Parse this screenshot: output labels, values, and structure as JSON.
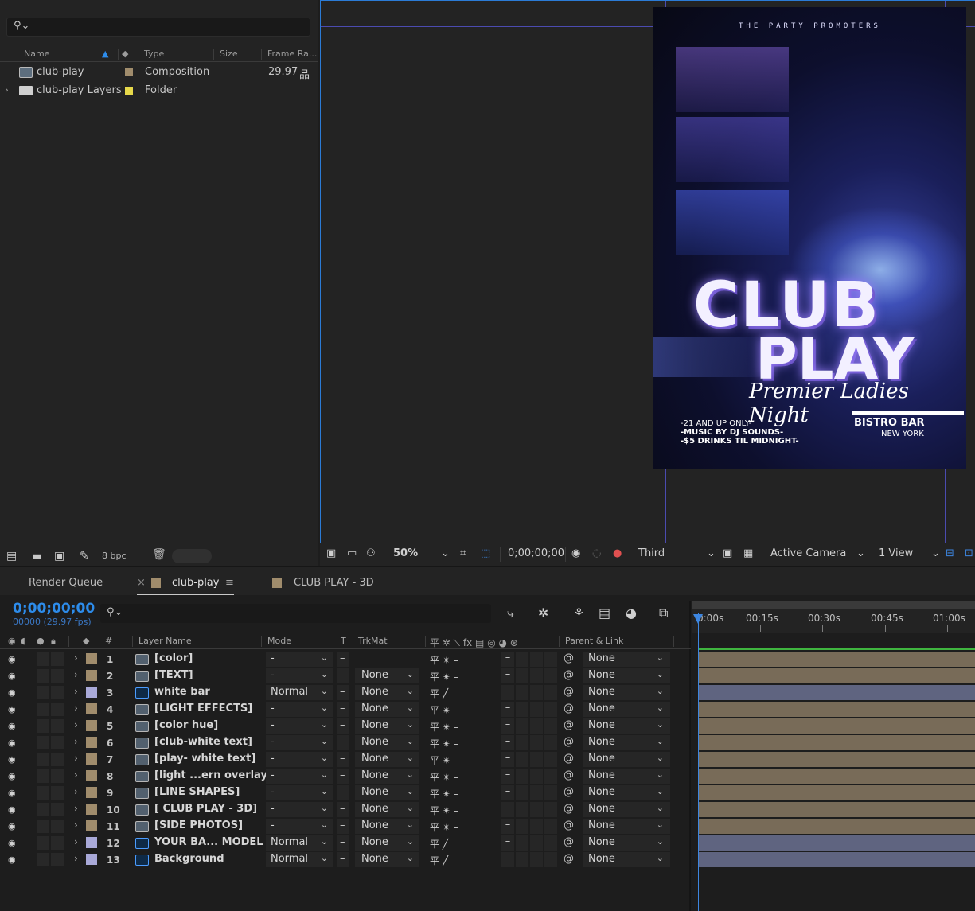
{
  "project": {
    "search_icon": "search-icon",
    "columns": {
      "name": "Name",
      "type": "Type",
      "size": "Size",
      "frame_rate": "Frame Ra..."
    },
    "items": [
      {
        "name": "club-play",
        "type": "Composition",
        "frame_rate": "29.97",
        "color": "#a08c6c"
      },
      {
        "name": "club-play Layers",
        "type": "Folder",
        "frame_rate": "",
        "color": "#e6d84a"
      }
    ],
    "bpc": "8 bpc"
  },
  "poster": {
    "promoters": "THE PARTY PROMOTERS",
    "club": "CLUB",
    "play": "PLAY",
    "premier": "Premier Ladies Night",
    "info": [
      "-21 AND UP ONLY-",
      "-MUSIC BY DJ SOUNDS-",
      "-$5 DRINKS TIL MIDNIGHT-"
    ],
    "bistro": "BISTRO BAR",
    "city": "NEW YORK"
  },
  "viewer_toolbar": {
    "zoom": "50%",
    "timecode": "0;00;00;00",
    "resolution": "Third",
    "camera": "Active Camera",
    "views": "1 View"
  },
  "tabs": {
    "render_queue": "Render Queue",
    "active": "club-play",
    "other": "CLUB PLAY - 3D"
  },
  "timeline": {
    "timecode": "0;00;00;00",
    "frames": "00000 (29.97 fps)",
    "headers": {
      "num": "#",
      "layer_name": "Layer Name",
      "mode": "Mode",
      "t": "T",
      "trkmat": "TrkMat",
      "parent": "Parent & Link"
    },
    "ruler": [
      "0:00s",
      "00:15s",
      "00:30s",
      "00:45s",
      "01:00s"
    ],
    "layers": [
      {
        "num": "1",
        "name": "[color]",
        "kind": "comp",
        "mode": "-",
        "trkmat": "",
        "label": "#a08c6c",
        "sw": "平 ✴ –",
        "parent": "None"
      },
      {
        "num": "2",
        "name": "[TEXT]",
        "kind": "comp",
        "mode": "-",
        "trkmat": "None",
        "label": "#a08c6c",
        "sw": "平 ✴ –",
        "parent": "None"
      },
      {
        "num": "3",
        "name": "white bar",
        "kind": "ps",
        "mode": "Normal",
        "trkmat": "None",
        "label": "#a9a9d8",
        "sw": "平   ╱",
        "parent": "None"
      },
      {
        "num": "4",
        "name": "[LIGHT EFFECTS]",
        "kind": "comp",
        "mode": "-",
        "trkmat": "None",
        "label": "#a08c6c",
        "sw": "平 ✴ –",
        "parent": "None"
      },
      {
        "num": "5",
        "name": "[color hue]",
        "kind": "comp",
        "mode": "-",
        "trkmat": "None",
        "label": "#a08c6c",
        "sw": "平 ✴ –",
        "parent": "None"
      },
      {
        "num": "6",
        "name": "[club-white text]",
        "kind": "comp",
        "mode": "-",
        "trkmat": "None",
        "label": "#a08c6c",
        "sw": "平 ✴ –",
        "parent": "None"
      },
      {
        "num": "7",
        "name": "[play- white text]",
        "kind": "comp",
        "mode": "-",
        "trkmat": "None",
        "label": "#a08c6c",
        "sw": "平 ✴ –",
        "parent": "None"
      },
      {
        "num": "8",
        "name": "[light ...ern overlay]",
        "kind": "comp",
        "mode": "-",
        "trkmat": "None",
        "label": "#a08c6c",
        "sw": "平 ✴ –",
        "parent": "None"
      },
      {
        "num": "9",
        "name": "[LINE SHAPES]",
        "kind": "comp",
        "mode": "-",
        "trkmat": "None",
        "label": "#a08c6c",
        "sw": "平 ✴ –",
        "parent": "None"
      },
      {
        "num": "10",
        "name": "[ CLUB PLAY - 3D]",
        "kind": "comp",
        "mode": "-",
        "trkmat": "None",
        "label": "#a08c6c",
        "sw": "平 ✴ –",
        "parent": "None"
      },
      {
        "num": "11",
        "name": "[SIDE PHOTOS]",
        "kind": "comp",
        "mode": "-",
        "trkmat": "None",
        "label": "#a08c6c",
        "sw": "平 ✴ –",
        "parent": "None"
      },
      {
        "num": "12",
        "name": "YOUR BA... MODEL",
        "kind": "ps",
        "mode": "Normal",
        "trkmat": "None",
        "label": "#a9a9d8",
        "sw": "平   ╱",
        "parent": "None"
      },
      {
        "num": "13",
        "name": "Background",
        "kind": "ps",
        "mode": "Normal",
        "trkmat": "None",
        "label": "#a9a9d8",
        "sw": "平   ╱",
        "parent": "None"
      }
    ]
  },
  "colors": {
    "accent": "#2d8ceb",
    "comp_bar": "#786b58",
    "ps_bar": "#5f6480",
    "work_area": "#3fb53f"
  }
}
